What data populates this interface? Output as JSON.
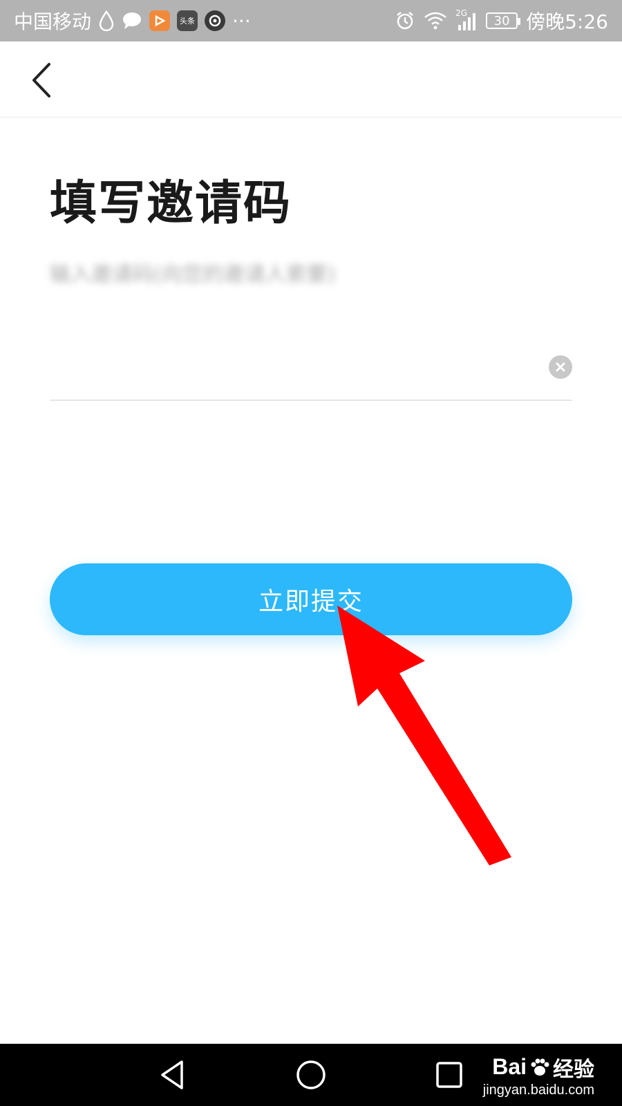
{
  "status_bar": {
    "carrier": "中国移动",
    "more": "···",
    "network": "2G",
    "battery": "30",
    "time": "傍晚5:26",
    "app_badge_toutiao": "头条",
    "icons": [
      "droplet-icon",
      "chat-bubble-icon",
      "video-app-icon",
      "toutiao-app-icon",
      "camera-app-icon",
      "alarm-icon",
      "wifi-icon",
      "signal-icon",
      "battery-icon"
    ]
  },
  "header": {
    "back_icon": "chevron-left-icon"
  },
  "main": {
    "title": "填写邀请码",
    "hint": "输入邀请码(向您的邀请人索要)",
    "input_value": "",
    "clear_icon": "close-circle-icon",
    "submit_label": "立即提交"
  },
  "colors": {
    "accent": "#2cb8fb",
    "status_bar_bg": "#b3b3b3",
    "arrow": "#ff0000"
  },
  "system_nav": {
    "icons": [
      "back-triangle-icon",
      "home-circle-icon",
      "recent-square-icon"
    ]
  },
  "watermark": {
    "brand": "Bai",
    "brand_suffix": "经验",
    "url": "jingyan.baidu.com"
  }
}
